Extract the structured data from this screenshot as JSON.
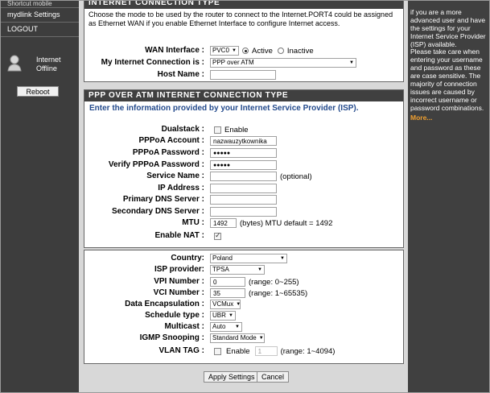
{
  "nav": {
    "cut_item": "Shortcut mobile",
    "items": [
      "mydlink Settings",
      "LOGOUT"
    ],
    "status_line1": "Internet",
    "status_line2": "Offline",
    "reboot_label": "Reboot"
  },
  "internet_panel": {
    "title": "INTERNET CONNECTION TYPE",
    "description": "Choose the mode to be used by the router to connect to the Internet.PORT4 could be assigned as Ethernet WAN if you enable Ethernet Interface to configure Internet access.",
    "wan_interface": {
      "label": "WAN Interface :",
      "value": "PVC0",
      "active": "Active",
      "inactive": "Inactive"
    },
    "connection": {
      "label": "My Internet Connection is :",
      "value": "PPP over ATM"
    },
    "host_name": {
      "label": "Host Name :",
      "value": ""
    }
  },
  "ppp_panel": {
    "title": "PPP OVER ATM INTERNET CONNECTION TYPE",
    "note": "Enter the information provided by your Internet Service Provider (ISP).",
    "dualstack": {
      "label": "Dualstack :",
      "text": "Enable"
    },
    "account": {
      "label": "PPPoA Account :",
      "value": "nazwauzytkownika"
    },
    "password": {
      "label": "PPPoA Password :",
      "value": "●●●●●"
    },
    "verify": {
      "label": "Verify PPPoA Password :",
      "value": "●●●●●"
    },
    "service": {
      "label": "Service Name :",
      "value": "",
      "note": "(optional)"
    },
    "ip": {
      "label": "IP Address :",
      "value": ""
    },
    "dns1": {
      "label": "Primary DNS Server :",
      "value": ""
    },
    "dns2": {
      "label": "Secondary DNS Server :",
      "value": ""
    },
    "mtu": {
      "label": "MTU :",
      "value": "1492",
      "note": "(bytes) MTU default = 1492"
    },
    "nat": {
      "label": "Enable NAT :"
    }
  },
  "atm_panel": {
    "country": {
      "label": "Country:",
      "value": "Poland"
    },
    "isp": {
      "label": "ISP provider:",
      "value": "TPSA"
    },
    "vpi": {
      "label": "VPI Number :",
      "value": "0",
      "note": "(range: 0~255)"
    },
    "vci": {
      "label": "VCI Number :",
      "value": "35",
      "note": "(range: 1~65535)"
    },
    "encap": {
      "label": "Data Encapsulation :",
      "value": "VCMux"
    },
    "schedule": {
      "label": "Schedule type :",
      "value": "UBR"
    },
    "multicast": {
      "label": "Multicast :",
      "value": "Auto"
    },
    "igmp": {
      "label": "IGMP Snooping :",
      "value": "Standard Mode"
    },
    "vlan": {
      "label": "VLAN TAG :",
      "text": "Enable",
      "value": "1",
      "note": "(range: 1~4094)"
    }
  },
  "buttons": {
    "apply": "Apply Settings",
    "cancel": "Cancel"
  },
  "help": {
    "para1": "if you are a more advanced user and have the settings for your Internet Service Provider (ISP) available.",
    "para2": "Please take care when entering your username and password as these are case sensitive. The majority of connection issues are caused by incorrect username or password combinations.",
    "more": "More..."
  }
}
